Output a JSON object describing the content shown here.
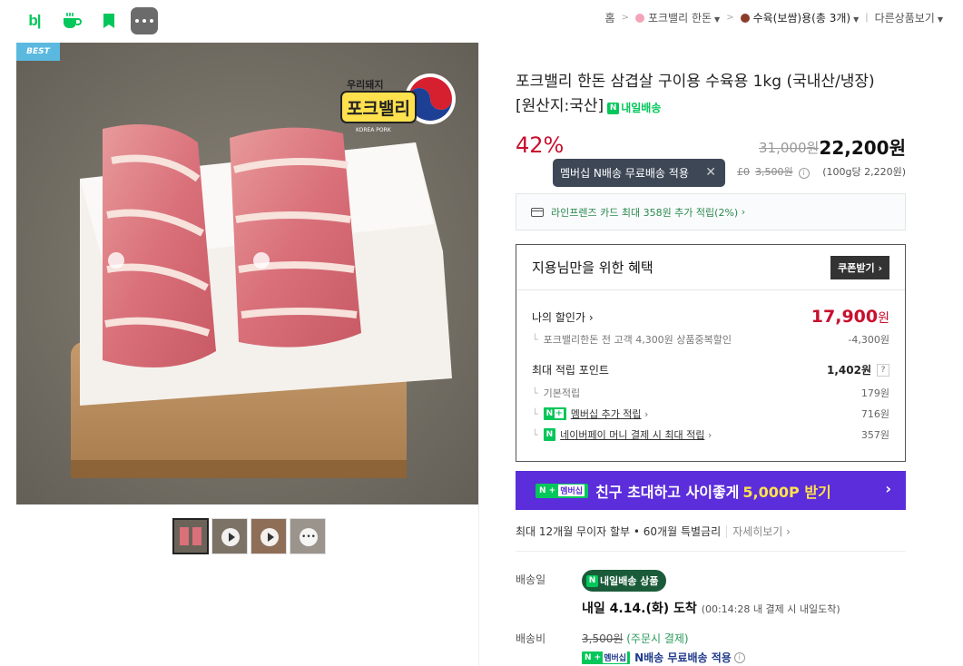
{
  "topbar": {
    "icons": [
      "blog-icon",
      "cafe-icon",
      "bookmark-icon",
      "more-icon"
    ],
    "blog_label": "b|",
    "breadcrumb": {
      "home": "홈",
      "store": "포크밸리 한돈",
      "category": "수육(보쌈)용",
      "category_count": "(총 3개)",
      "other": "다른상품보기"
    }
  },
  "product": {
    "best_badge": "BEST",
    "logo_top": "우리돼지",
    "logo_main": "포크밸리",
    "logo_sub": "KOREA PORK",
    "thumbnail_count": 4,
    "title": "포크밸리 한돈 삼겹살 구이용 수육용 1kg (국내산/냉장) [원산지:국산]",
    "nextday_label": "내일배송",
    "discount": "42%",
    "original_price": "31,000원",
    "sale_price": "22,200원",
    "tooltip": "멤버십 N배송 무료배송 적용",
    "shipping_prefix": "£0",
    "shipping_strike": "3,500원",
    "unit_price": "(100g당 2,220원)"
  },
  "card_offer": "라인프렌즈 카드 최대 358원 추가 적립(2%)",
  "benefit": {
    "title": "지용님만을 위한 혜택",
    "coupon_button": "쿠폰받기",
    "my_price_label": "나의 할인가",
    "my_price_number": "17,900",
    "my_price_unit": "원",
    "discount_detail": "포크밸리한돈 전 고객 4,300원 상품중복할인",
    "discount_detail_value": "-4,300원",
    "max_points_label": "최대 적립 포인트",
    "max_points_value": "1,402원",
    "question_mark": "?",
    "rows": [
      {
        "label": "기본적립",
        "value": "179원"
      },
      {
        "label": "멤버십 추가 적립",
        "value": "716원"
      },
      {
        "label": "네이버페이 머니 결제 시 최대 적립",
        "value": "357원"
      }
    ]
  },
  "promo": {
    "tag_n": "N +",
    "tag_member": "멤버십",
    "text": "친구 초대하고 사이좋게",
    "highlight": "5,000P 받기"
  },
  "installment": {
    "text": "최대 12개월 무이자 할부 • 60개월 특별금리",
    "more": "자세히보기"
  },
  "delivery": {
    "date_label": "배송일",
    "badge": "내일배송 상품",
    "arrive": "내일 4.14.(화) 도착",
    "arrive_note": "(00:14:28 내 결제 시 내일도착)",
    "fee_label": "배송비",
    "fee_strike": "3,500원",
    "fee_note": "(주문시 결제)",
    "free_shipping": "N배송 무료배송 적용"
  }
}
